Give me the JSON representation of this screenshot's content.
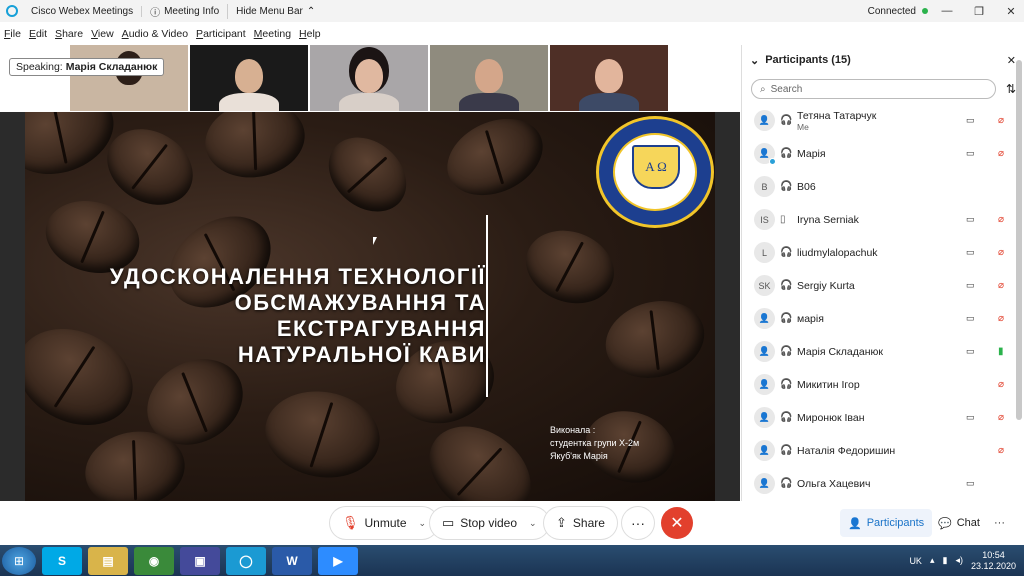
{
  "titlebar": {
    "app_title": "Cisco Webex Meetings",
    "meeting_info": "Meeting Info",
    "hide_menu": "Hide Menu Bar",
    "status": "Connected"
  },
  "menu": [
    "File",
    "Edit",
    "Share",
    "View",
    "Audio & Video",
    "Participant",
    "Meeting",
    "Help"
  ],
  "speaking": {
    "label": "Speaking:",
    "name": "Марія Складанюк"
  },
  "slide": {
    "title_lines": [
      "УДОСКОНАЛЕННЯ ТЕХНОЛОГІЇ",
      "ОБСМАЖУВАННЯ ТА ЕКСТРАГУВАННЯ",
      "НАТУРАЛЬНОЇ  КАВИ"
    ],
    "author_lines": [
      "Виконала :",
      "студентка групи Х-2м",
      "Якуб'як Марія"
    ],
    "seal_text": "A  Ω"
  },
  "controls": {
    "unmute": "Unmute",
    "stop_video": "Stop video",
    "share": "Share",
    "participants": "Participants",
    "chat": "Chat"
  },
  "panel": {
    "title": "Participants (15)",
    "search_placeholder": "Search",
    "participants": [
      {
        "initials": "",
        "name": "Тетяна Татарчук",
        "sub": "Me",
        "cam": true,
        "mic": "muted"
      },
      {
        "initials": "",
        "name": "Марія",
        "sub": "",
        "cam": true,
        "mic": "muted"
      },
      {
        "initials": "B",
        "name": "B06",
        "sub": "",
        "cam": false,
        "mic": "none"
      },
      {
        "initials": "IS",
        "name": "Iryna Serniak",
        "sub": "",
        "cam": true,
        "mic": "muted"
      },
      {
        "initials": "L",
        "name": "liudmylalopachuk",
        "sub": "",
        "cam": true,
        "mic": "muted"
      },
      {
        "initials": "SK",
        "name": "Sergiy Kurta",
        "sub": "",
        "cam": true,
        "mic": "muted"
      },
      {
        "initials": "",
        "name": "марія",
        "sub": "",
        "cam": true,
        "mic": "muted"
      },
      {
        "initials": "",
        "name": "Марія Складанюк",
        "sub": "",
        "cam": true,
        "mic": "active"
      },
      {
        "initials": "",
        "name": "Микитин Ігор",
        "sub": "",
        "cam": false,
        "mic": "muted"
      },
      {
        "initials": "",
        "name": "Миронюк Іван",
        "sub": "",
        "cam": true,
        "mic": "muted"
      },
      {
        "initials": "",
        "name": "Наталія Федоришин",
        "sub": "",
        "cam": false,
        "mic": "muted"
      },
      {
        "initials": "",
        "name": "Ольга Хацевич",
        "sub": "",
        "cam": true,
        "mic": "none"
      }
    ]
  },
  "taskbar": {
    "lang": "UK",
    "time": "10:54",
    "date": "23.12.2020"
  },
  "colors": {
    "accent": "#1a73c8",
    "leave": "#e2402d",
    "mic_muted": "#e2402d",
    "mic_active": "#2bb24c"
  }
}
